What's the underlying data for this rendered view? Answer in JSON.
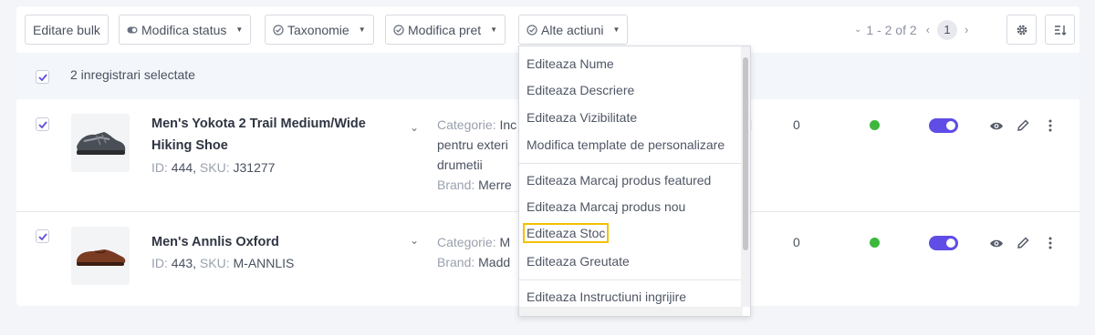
{
  "toolbar": {
    "bulk_edit": "Editare bulk",
    "status": "Modifica status",
    "taxonomy": "Taxonomie",
    "price": "Modifica pret",
    "other_actions": "Alte actiuni"
  },
  "pagination": {
    "range": "1 - 2 of 2",
    "page": "1"
  },
  "selection": {
    "text": "2 inregistrari selectate"
  },
  "products": [
    {
      "name": "Men's Yokota 2 Trail Medium/Wide Hiking Shoe",
      "id_label": "ID:",
      "id": "444",
      "sku_label": "SKU:",
      "sku": "J31277",
      "category_label": "Categorie:",
      "category_lines": [
        "Inc",
        "pentru exteri",
        "drumetii"
      ],
      "brand_label": "Brand:",
      "brand": "Merre",
      "stock": "0"
    },
    {
      "name": "Men's Annlis Oxford",
      "id_label": "ID:",
      "id": "443",
      "sku_label": "SKU:",
      "sku": "M-ANNLIS",
      "category_label": "Categorie:",
      "category_lines": [
        "M"
      ],
      "brand_label": "Brand:",
      "brand": "Madd",
      "stock": "0"
    }
  ],
  "dropdown": {
    "items": [
      "Editeaza Nume",
      "Editeaza Descriere",
      "Editeaza Vizibilitate",
      "Modifica template de personalizare",
      "Editeaza Marcaj produs featured",
      "Editeaza Marcaj produs nou",
      "Editeaza Stoc",
      "Editeaza Greutate",
      "Editeaza Instructiuni ingrijire"
    ]
  },
  "colors": {
    "accent": "#5f4de6",
    "status_active": "#3cb83c",
    "highlight": "#f2c200"
  }
}
